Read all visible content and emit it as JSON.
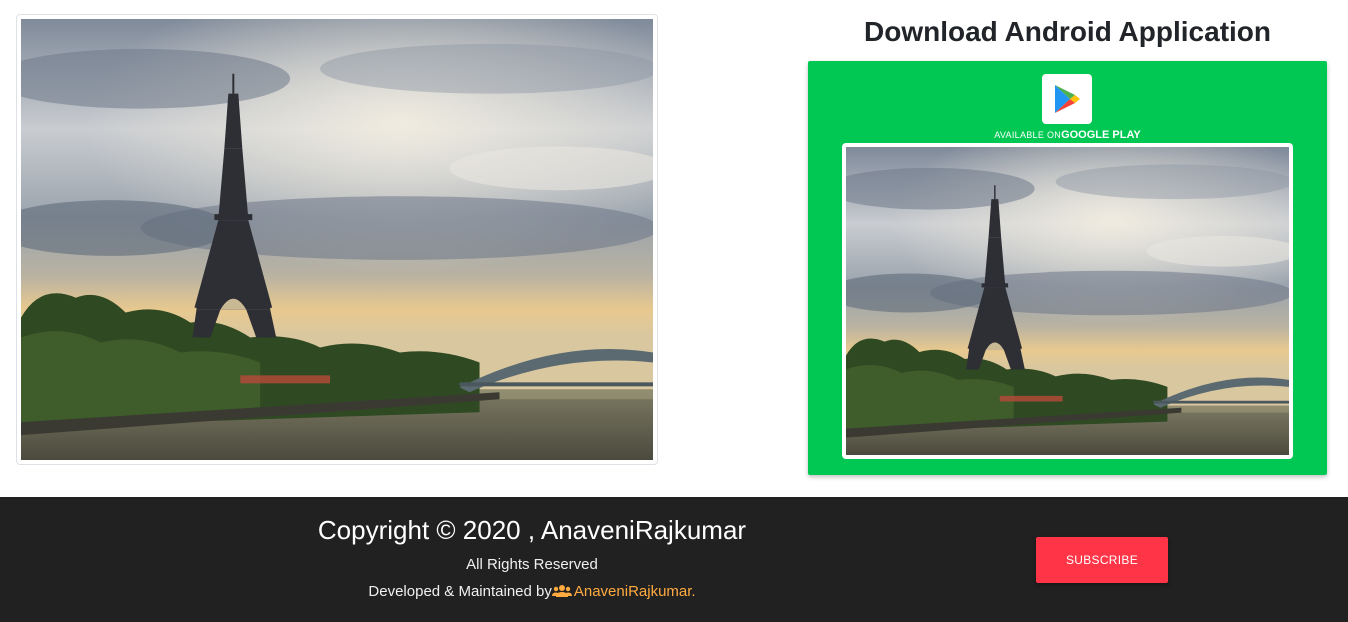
{
  "download": {
    "title": "Download Android Application",
    "available_label": "AVAILABLE ON",
    "store_label": "GOOGLE PLAY"
  },
  "images": {
    "main_photo": "eiffel-tower-river-photo",
    "app_preview_photo": "eiffel-tower-river-photo"
  },
  "icons": {
    "store": "google-play-icon",
    "developer": "users-icon"
  },
  "footer": {
    "copyright": "Copyright © 2020 , AnaveniRajkumar",
    "rights": "All Rights Reserved",
    "developed_prefix": "Developed & Maintained by",
    "developer_link": "AnaveniRajkumar.",
    "subscribe_label": "SUBSCRIBE"
  },
  "colors": {
    "play_box": "#00c853",
    "footer_bg": "#212121",
    "subscribe": "#ff3547",
    "link": "#ffab40"
  }
}
